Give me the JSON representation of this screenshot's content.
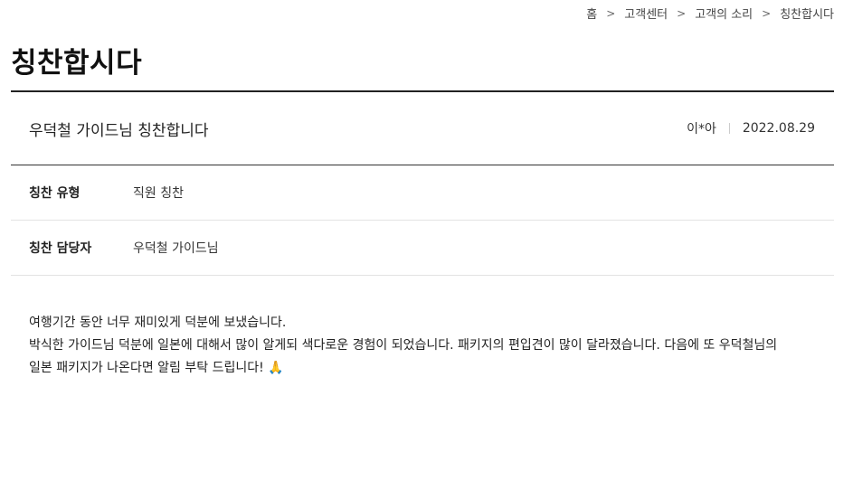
{
  "breadcrumb": {
    "items": [
      "홈",
      "고객센터",
      "고객의 소리",
      "칭찬합시다"
    ],
    "separator": ">"
  },
  "page": {
    "title": "칭찬합시다"
  },
  "post": {
    "title": "우덕철 가이드님 칭찬합니다",
    "author": "이*아",
    "date": "2022.08.29"
  },
  "details": {
    "type_label": "칭찬 유형",
    "type_value": "직원 칭찬",
    "staff_label": "칭찬 담당자",
    "staff_value": "우덕철 가이드님"
  },
  "body": {
    "line1": "여행기간 동안 너무 재미있게 덕분에 보냈습니다.",
    "line2": "박식한 가이드님 덕분에 일본에 대해서 많이 알게되 색다로운 경험이 되었습니다. 패키지의 편입견이 많이 달라졌습니다. 다음에 또 우덕철님의",
    "line3": "일본 패키지가 나온다면 알림 부탁 드립니다! 🙏"
  }
}
